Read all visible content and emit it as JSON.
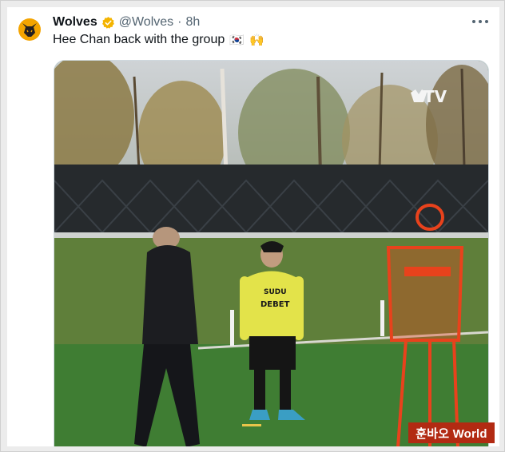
{
  "tweet": {
    "author_name": "Wolves",
    "handle": "@Wolves",
    "separator": "·",
    "time": "8h",
    "text": "Hee Chan back with the group",
    "emojis": [
      "🇰🇷",
      "🙌"
    ]
  },
  "media": {
    "channel_logo_text": "TV",
    "shirt_text_line1": "SUDU",
    "shirt_text_line2": "DEBET"
  },
  "watermark": {
    "text": "훈바오 World"
  },
  "colors": {
    "verified_badge": "#f4b400",
    "avatar_badge": "#f4a400",
    "watermark_bg": "#b22a12",
    "pitch": "#3f7d33",
    "training_mannequin": "#e8421c"
  },
  "icons": [
    "wolves-crest-icon",
    "verified-badge-icon",
    "more-options-icon"
  ]
}
